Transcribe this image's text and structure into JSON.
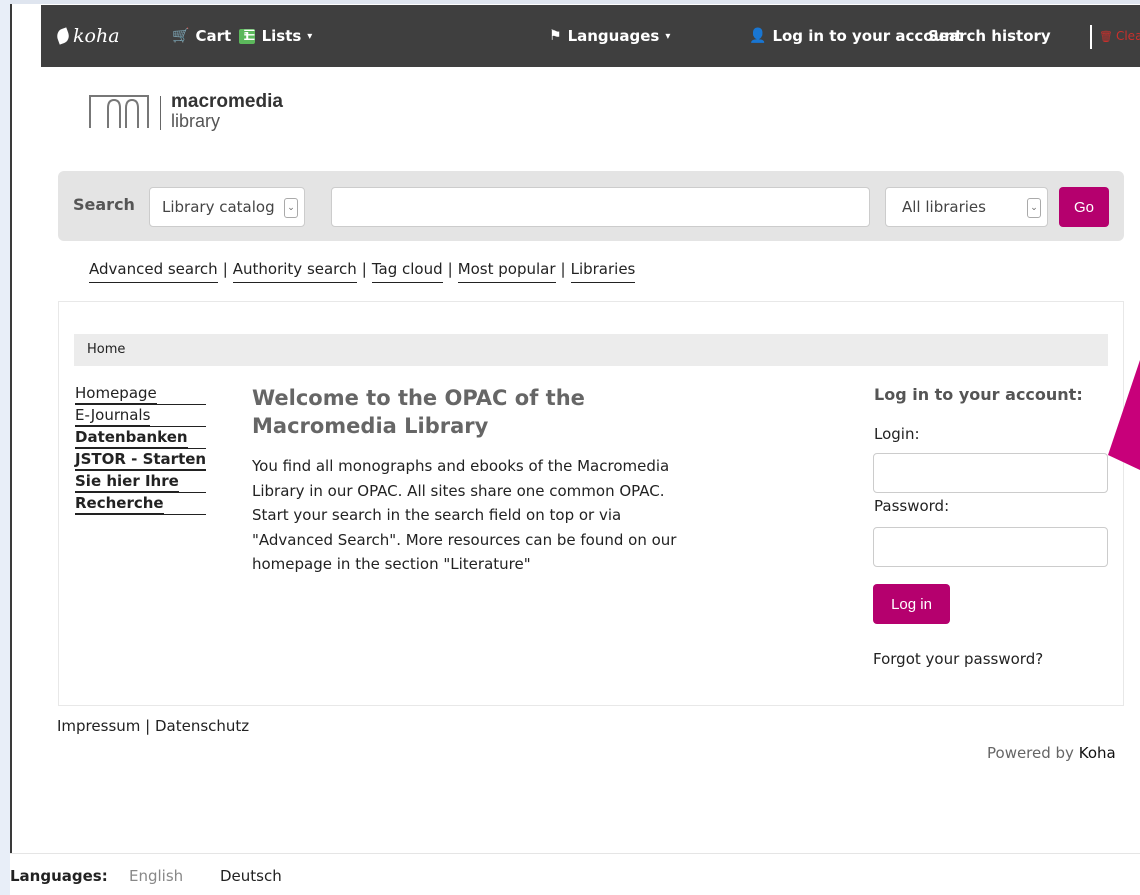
{
  "navbar": {
    "brand": "koha",
    "cart_label": "Cart",
    "cart_count": "1",
    "lists_label": "Lists",
    "languages_label": "Languages",
    "login_label": "Log in to your account",
    "history_label": "Search history",
    "clear_label": "Clear"
  },
  "logo": {
    "line1": "macromedia",
    "line2": "library"
  },
  "search": {
    "label": "Search",
    "catalog_select": "Library catalog",
    "query": "",
    "library_select": "All libraries",
    "go_label": "Go"
  },
  "more_links": [
    "Advanced search",
    "Authority search",
    "Tag cloud",
    "Most popular",
    "Libraries"
  ],
  "breadcrumb": "Home",
  "side_nav": {
    "homepage": "Homepage",
    "ejournals": "E-Journals",
    "datenbanken": "Datenbanken",
    "jstor": "JSTOR - Starten",
    "sie_hier": "Sie hier Ihre",
    "recherche": "Recherche"
  },
  "welcome": {
    "title": "Welcome to the OPAC of the Macromedia Library",
    "body": "You find all monographs and ebooks of the Macromedia Library in our OPAC. All sites share one common OPAC. Start your search in the search field on top or via \"Advanced Search\". More resources can be found on our homepage in the section \"Literature\""
  },
  "login": {
    "title": "Log in to your account:",
    "login_label": "Login:",
    "password_label": "Password:",
    "button": "Log in",
    "forgot": "Forgot your password?"
  },
  "footer": {
    "impressum": "Impressum",
    "datenschutz": "Datenschutz",
    "powered_prefix": "Powered by",
    "powered_name": "Koha"
  },
  "languages_bar": {
    "label": "Languages:",
    "english": "English",
    "deutsch": "Deutsch"
  },
  "colors": {
    "navbar": "#3f3f3f",
    "accent": "#b5006e",
    "cart_badge": "#5cb85c",
    "clear": "#c9302c"
  }
}
